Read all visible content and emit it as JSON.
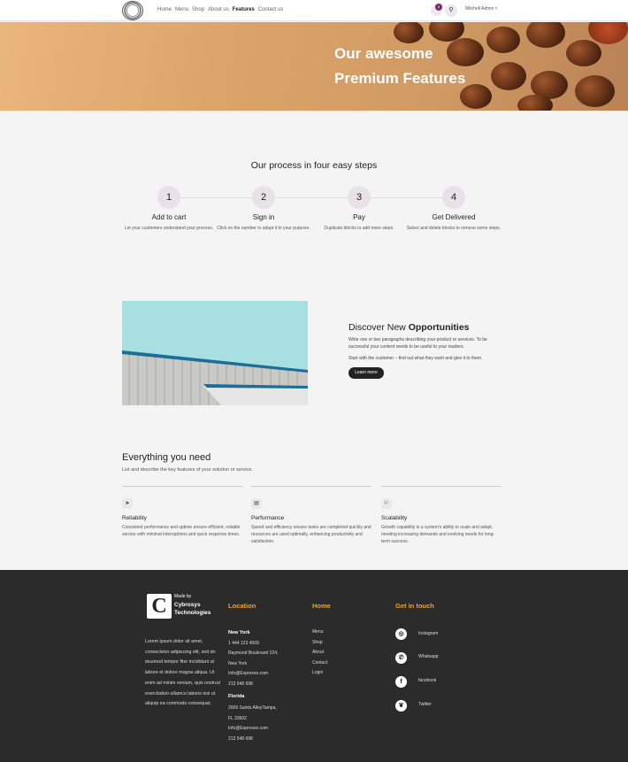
{
  "header": {
    "nav": [
      "Home",
      "Menu",
      "Shop",
      "About us",
      "Features",
      "Contact us"
    ],
    "active_nav": "Features",
    "cart_count": "0",
    "user": "Mitchell Admin"
  },
  "hero": {
    "line1": "Our awesome",
    "line2": "Premium Features"
  },
  "process": {
    "title": "Our process in four easy steps",
    "steps": [
      {
        "num": "1",
        "title": "Add to cart",
        "desc": "Let your customers understand your process."
      },
      {
        "num": "2",
        "title": "Sign in",
        "desc": "Click on the number to adapt it to your purpose."
      },
      {
        "num": "3",
        "title": "Pay",
        "desc": "Duplicate blocks to add more steps."
      },
      {
        "num": "4",
        "title": "Get Delivered",
        "desc": "Select and delete blocks to remove some steps."
      }
    ]
  },
  "discover": {
    "title_plain": "Discover New ",
    "title_bold": "Opportunities",
    "p1": "Write one or two paragraphs describing your product or services. To be successful your content needs to be useful to your readers.",
    "p2": "Start with the customer – find out what they want and give it to them.",
    "button": "Learn more"
  },
  "features": {
    "title": "Everything you need",
    "subtitle": "List and describe the key features of your solution or service.",
    "items": [
      {
        "icon": "rocket-icon",
        "name": "Reliability",
        "desc": "Consistent performance and uptime ensure efficient, reliable service with minimal interruptions and quick response times."
      },
      {
        "icon": "card-icon",
        "name": "Performance",
        "desc": "Speed and efficiency ensure tasks are completed quickly and resources are used optimally, enhancing productivity and satisfaction."
      },
      {
        "icon": "flag-icon",
        "name": "Scalability",
        "desc": "Growth capability is a system's ability to scale and adapt, meeting increasing demands and evolving needs for long-term success."
      }
    ]
  },
  "footer": {
    "made_by": "Made by",
    "company1": "Cybrosys",
    "company2": "Technologies",
    "lorem": "Lorem ipsum dolor sit amet, consectetur adipiscing elit, sed do eiusmod tempor fiter incididunt ut labore et dolore magna aliqua. Ut enim ad minim veniam, quis nostrud exercitation ullamco laboris nisi ut aliquip ea commodo consequat.",
    "location_title": "Location",
    "ny": {
      "city": "New York",
      "phone": "1 444 123 4559",
      "addr1": "Raymond Boulevard 224,",
      "addr2": "New York",
      "email": "Info@Espresso.com",
      "phone2": "213 548 698"
    },
    "fl": {
      "city": "Florida",
      "addr1": "2606 Saints AlleyTampa,",
      "addr2": "FL 33602",
      "email": "Info@Espresso.com",
      "phone2": "213 548 698"
    },
    "home_title": "Home",
    "home_links": [
      "Menu",
      "Shop",
      "About",
      "Contact",
      "Login"
    ],
    "touch_title": "Get in touch",
    "socials": [
      {
        "icon": "instagram-icon",
        "label": "Instagram"
      },
      {
        "icon": "whatsapp-icon",
        "label": "Whatsapp"
      },
      {
        "icon": "facebook-icon",
        "label": "facebook"
      },
      {
        "icon": "twitter-icon",
        "label": "Twitter"
      }
    ]
  },
  "colors": {
    "accent": "#e8a33c",
    "footer_bg": "#2b2b2b",
    "button": "#222222",
    "badge": "#7b2a6a"
  }
}
